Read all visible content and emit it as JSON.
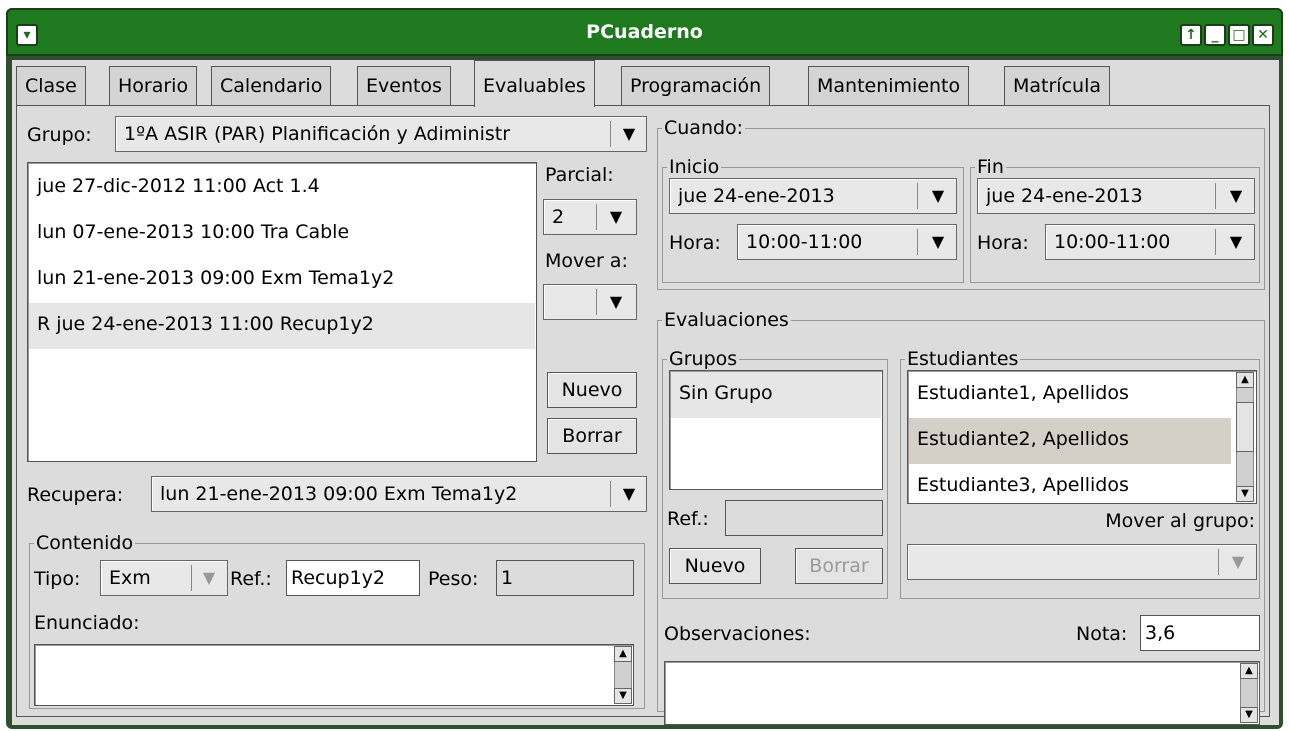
{
  "window": {
    "title": "PCuaderno",
    "menu_icon": "chevron-down-icon",
    "controls": [
      "maximize-up-icon",
      "minimize-icon",
      "restore-icon",
      "close-icon"
    ]
  },
  "tabs": [
    "Clase",
    "Horario",
    "Calendario",
    "Eventos",
    "Evaluables",
    "Programación",
    "Mantenimiento",
    "Matrícula"
  ],
  "active_tab": "Evaluables",
  "left": {
    "grupo_label": "Grupo:",
    "grupo_value": "1ºA ASIR (PAR) Planificación y Adiministr",
    "evaluables": [
      "jue 27-dic-2012 11:00 Act 1.4",
      "lun 07-ene-2013 10:00 Tra Cable",
      "lun 21-ene-2013 09:00 Exm Tema1y2",
      "R jue 24-ene-2013 11:00 Recup1y2"
    ],
    "parcial_label": "Parcial:",
    "parcial_value": "2",
    "mover_label": "Mover a:",
    "mover_value": "",
    "nuevo": "Nuevo",
    "borrar": "Borrar",
    "recupera_label": "Recupera:",
    "recupera_value": "lun 21-ene-2013 09:00 Exm Tema1y2",
    "contenido": {
      "title": "Contenido",
      "tipo_label": "Tipo:",
      "tipo_value": "Exm",
      "ref_label": "Ref.:",
      "ref_value": "Recup1y2",
      "peso_label": "Peso:",
      "peso_value": "1",
      "enunciado_label": "Enunciado:",
      "enunciado_value": ""
    }
  },
  "cuando": {
    "title": "Cuando:",
    "inicio": {
      "title": "Inicio",
      "fecha": "jue 24-ene-2013",
      "hora_label": "Hora:",
      "hora": "10:00-11:00"
    },
    "fin": {
      "title": "Fin",
      "fecha": "jue 24-ene-2013",
      "hora_label": "Hora:",
      "hora": "10:00-11:00"
    }
  },
  "evaluaciones": {
    "title": "Evaluaciones",
    "grupos": {
      "title": "Grupos",
      "items": [
        "Sin Grupo"
      ],
      "ref_label": "Ref.:",
      "ref_value": "",
      "nuevo": "Nuevo",
      "borrar": "Borrar"
    },
    "estudiantes": {
      "title": "Estudiantes",
      "items": [
        "Estudiante1, Apellidos",
        "Estudiante2, Apellidos",
        "Estudiante3, Apellidos"
      ],
      "mover_label": "Mover al grupo:",
      "mover_value": ""
    },
    "observaciones_label": "Observaciones:",
    "observaciones_value": "",
    "nota_label": "Nota:",
    "nota_value": "3,6"
  }
}
